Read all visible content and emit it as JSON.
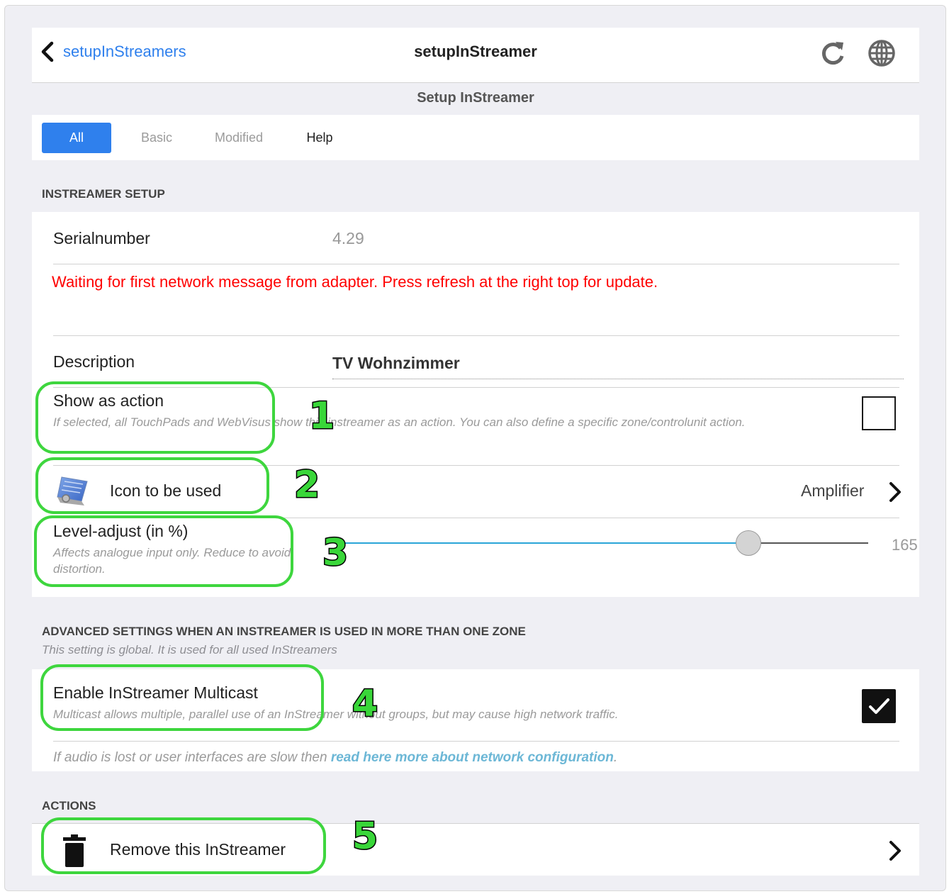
{
  "nav": {
    "back_label": "setupInStreamers",
    "title": "setupInStreamer",
    "icons": [
      "chevron-left-icon",
      "refresh-icon",
      "globe-icon"
    ]
  },
  "subheader": {
    "title": "Setup InStreamer"
  },
  "tabs": [
    {
      "label": "All",
      "state": "active"
    },
    {
      "label": "Basic",
      "state": "inactive"
    },
    {
      "label": "Modified",
      "state": "inactive"
    },
    {
      "label": "Help",
      "state": "normal"
    }
  ],
  "setup": {
    "header": "INSTREAMER SETUP",
    "serial_label": "Serialnumber",
    "serial_value": "4.29",
    "warning": "Waiting for first network message from adapter. Press refresh at the right top for update.",
    "description_label": "Description",
    "description_value": "TV Wohnzimmer",
    "show_action_label": "Show as action",
    "show_action_desc": "If selected, all TouchPads and WebVisus show this instreamer as an action. You can also define a specific zone/controlunit action.",
    "show_action_checked": false,
    "icon_label": "Icon to be used",
    "icon_value": "Amplifier",
    "level_label": "Level-adjust (in %)",
    "level_desc": "Affects analogue input only. Reduce to avoid distortion.",
    "level_value": "165",
    "level_fraction": 0.775
  },
  "advanced": {
    "header": "ADVANCED SETTINGS WHEN AN INSTREAMER IS USED IN MORE THAN ONE ZONE",
    "sub": "This setting is global. It is used for all used InStreamers",
    "multicast_label": "Enable InStreamer Multicast",
    "multicast_desc": "Multicast allows multiple, parallel use of an InStreamer without groups, but may cause high network traffic.",
    "multicast_checked": true,
    "note_prefix": "If audio is lost or user interfaces are slow then ",
    "note_link": "read here more about network configuration",
    "note_suffix": "."
  },
  "actions": {
    "header": "ACTIONS",
    "remove_label": "Remove this InStreamer"
  },
  "annotations": [
    "1",
    "2",
    "3",
    "4",
    "5"
  ],
  "colors": {
    "accent": "#2f80ed",
    "warning": "#ff0000",
    "annotation": "#3ed63e",
    "slider_track": "#2aa5d8",
    "link": "#6cb7d6"
  }
}
